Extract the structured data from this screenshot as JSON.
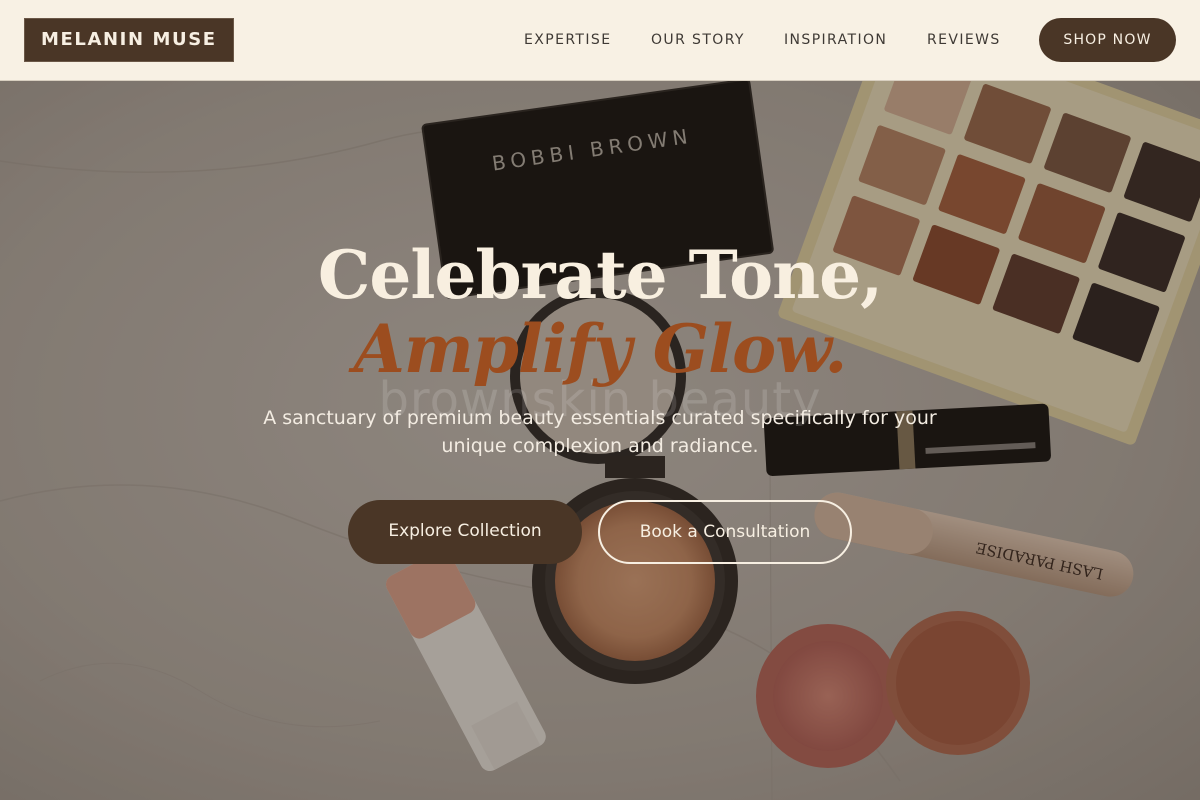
{
  "header": {
    "logo": "MELANIN MUSE",
    "nav": {
      "expertise": "EXPERTISE",
      "story": "OUR STORY",
      "inspiration": "INSPIRATION",
      "reviews": "REVIEWS"
    },
    "cta": "SHOP NOW"
  },
  "hero": {
    "headline_line1": "Celebrate Tone,",
    "headline_line2": "Amplify Glow.",
    "watermark": "brownskin beauty",
    "subtitle": "A sanctuary of premium beauty essentials curated specifically for your unique complexion and radiance.",
    "primary_button": "Explore Collection",
    "secondary_button": "Book a Consultation",
    "photo_props": {
      "compact_brand": "BOBBI BROWN",
      "mascara_brand": "LASH PARADISE"
    }
  },
  "colors": {
    "header_bg": "#f8f1e4",
    "brand_brown": "#4a3626",
    "accent_rust": "#9c4d1f",
    "cream_text": "#f8efe0"
  }
}
